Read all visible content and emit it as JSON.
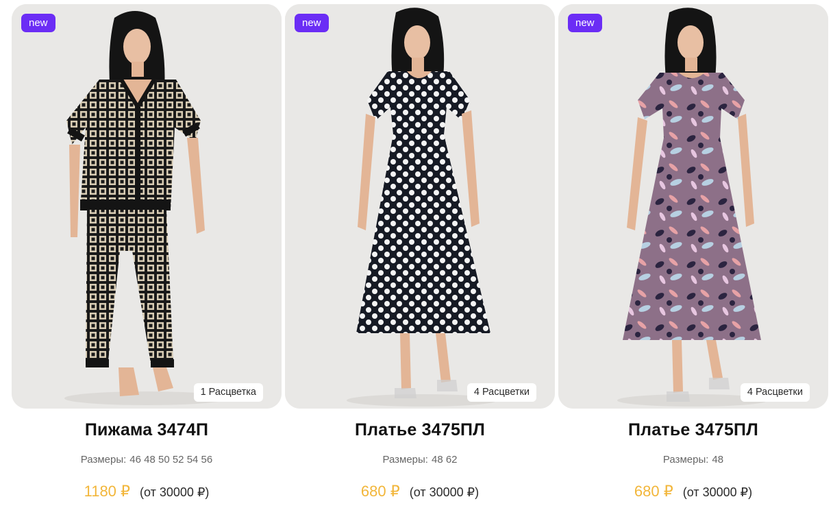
{
  "products": [
    {
      "badge": "new",
      "colors_label": "1 Расцветка",
      "title": "Пижама 3474П",
      "sizes_label": "Размеры:",
      "sizes": "46 48 50 52 54 56",
      "price": "1180 ₽",
      "wholesale": "(от 30000 ₽)",
      "image": "woman-in-patterned-pajamas"
    },
    {
      "badge": "new",
      "colors_label": "4 Расцветки",
      "title": "Платье 3475ПЛ",
      "sizes_label": "Размеры:",
      "sizes": "48 62",
      "price": "680 ₽",
      "wholesale": "(от 30000 ₽)",
      "image": "woman-in-polka-dot-dress"
    },
    {
      "badge": "new",
      "colors_label": "4 Расцветки",
      "title": "Платье 3475ПЛ",
      "sizes_label": "Размеры:",
      "sizes": "48",
      "price": "680 ₽",
      "wholesale": "(от 30000 ₽)",
      "image": "woman-in-floral-purple-dress"
    }
  ],
  "colors": {
    "badge_bg": "#6b2df5",
    "price": "#f2b63a",
    "card_bg": "#e9e8e6"
  }
}
